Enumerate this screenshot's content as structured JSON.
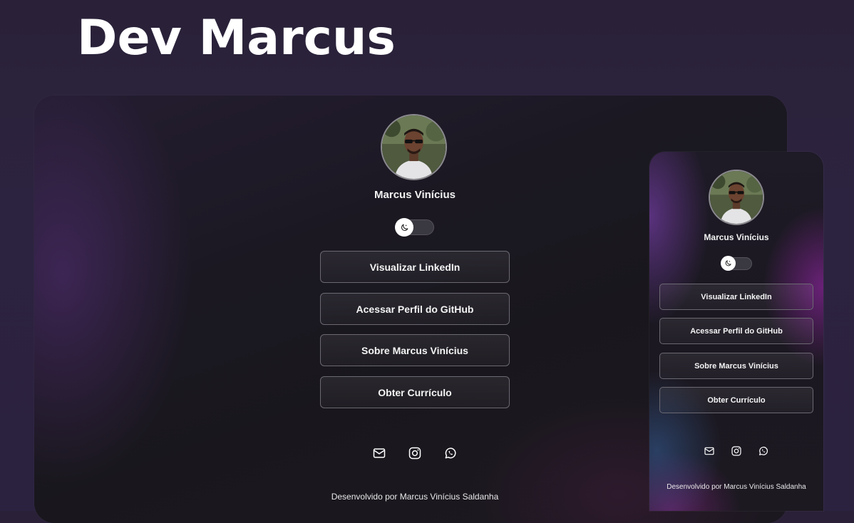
{
  "page": {
    "title": "Dev Marcus"
  },
  "profile": {
    "name": "Marcus Vinícius",
    "theme_toggle_icon": "moon-icon"
  },
  "links": [
    {
      "label": "Visualizar LinkedIn"
    },
    {
      "label": "Acessar Perfil do GitHub"
    },
    {
      "label": "Sobre Marcus Vinícius"
    },
    {
      "label": "Obter Currículo"
    }
  ],
  "socials": [
    {
      "icon": "mail-icon"
    },
    {
      "icon": "instagram-icon"
    },
    {
      "icon": "whatsapp-icon"
    }
  ],
  "footer": {
    "text": "Desenvolvido por Marcus Vinícius Saldanha"
  },
  "colors": {
    "background": "#2b2240",
    "card_background": "#1b1822",
    "button_border": "#6b6871",
    "text": "#ffffff"
  }
}
